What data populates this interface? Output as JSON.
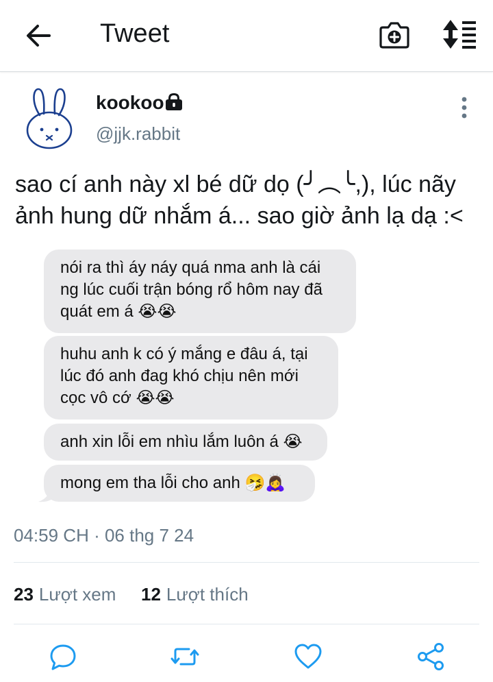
{
  "header": {
    "title": "Tweet",
    "back_icon": "arrow-left-icon",
    "camera_icon": "camera-icon",
    "sort_icon": "sort-icon"
  },
  "tweet": {
    "author": {
      "display_name": "kookoo",
      "handle": "@jjk.rabbit",
      "protected_icon": "lock-icon",
      "avatar_icon": "bunny-icon"
    },
    "text": "sao cí anh này xl bé dữ dọ (╯︵╰,), lúc nãy\nảnh hung dữ nhắm á... sao giờ ảnh lạ dạ :<",
    "image": {
      "messages": [
        "nói ra thì áy náy quá nma anh là cái\nng lúc cuối trận bóng rổ hôm nay đã\nquát em á 😭😭",
        "huhu anh k có ý mắng e đâu á, tại\nlúc đó anh đag khó chịu nên mới\ncọc vô cớ 😭😭",
        "anh xin lỗi em nhìu lắm luôn á 😭",
        "mong em tha lỗi cho anh 🤧🙇‍♀️"
      ],
      "bubble_color": "#e9e9eb"
    },
    "timestamp": "04:59 CH · 06 thg 7 24",
    "stats": {
      "views_count": "23",
      "views_label": "Lượt xem",
      "likes_count": "12",
      "likes_label": "Lượt thích"
    }
  },
  "actions": {
    "reply_icon": "reply-icon",
    "retweet_icon": "retweet-icon",
    "like_icon": "heart-icon",
    "share_icon": "share-icon",
    "icon_color": "#1d9bf0"
  },
  "colors": {
    "text": "#14171a",
    "secondary": "#657786",
    "accent": "#1d9bf0",
    "avatar_stroke": "#1b3f8f"
  }
}
